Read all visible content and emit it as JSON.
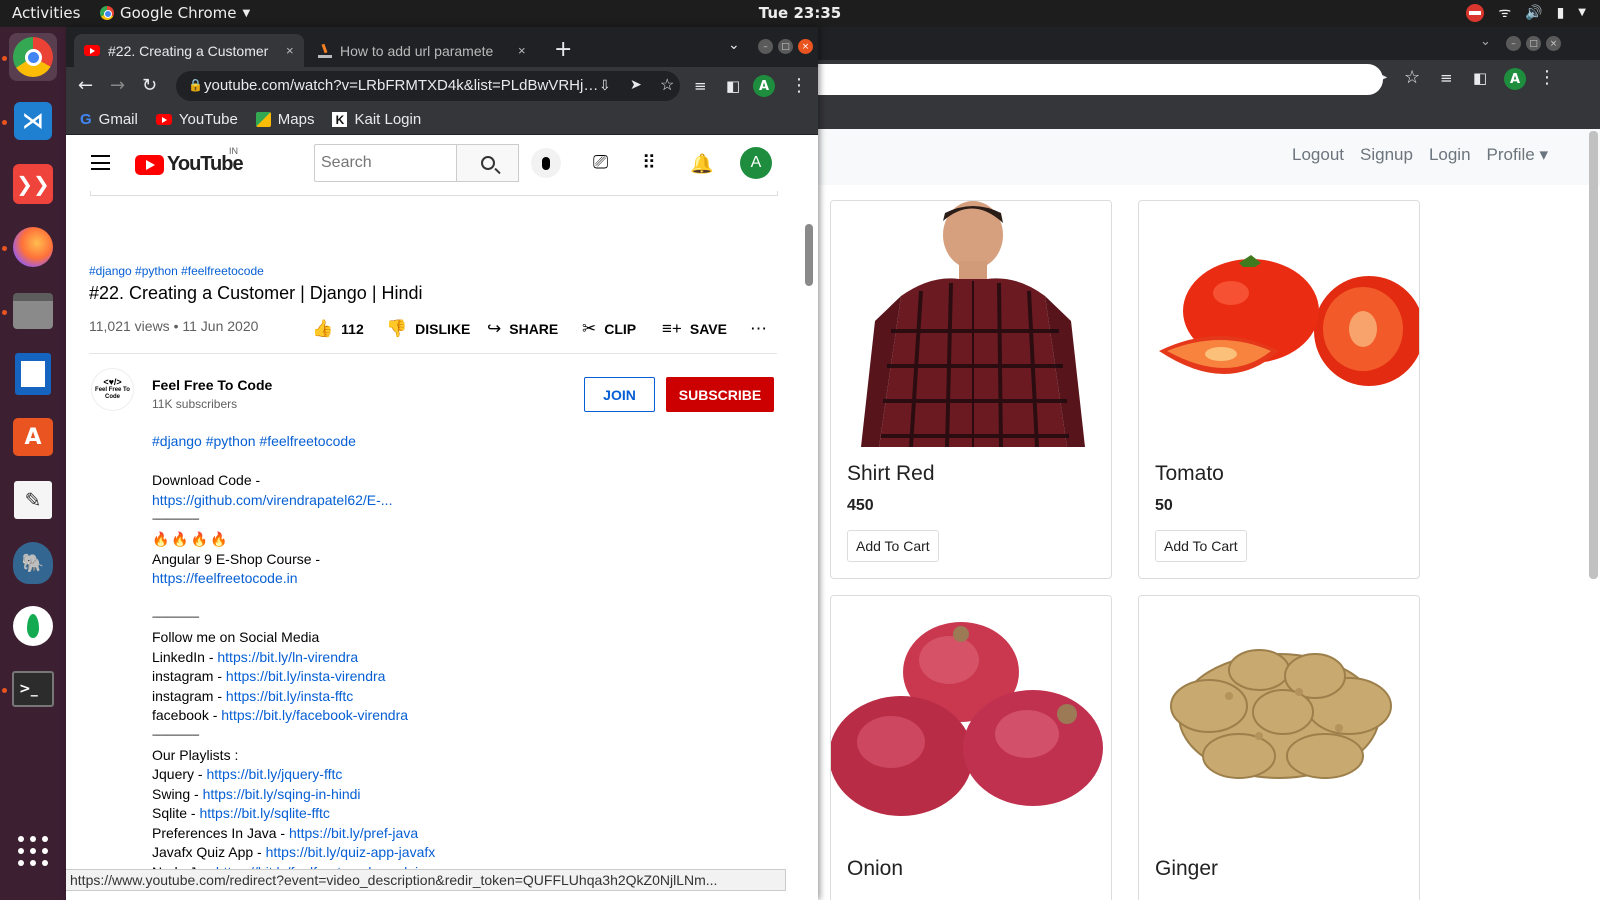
{
  "topbar": {
    "activities": "Activities",
    "app_name": "Google Chrome",
    "clock": "Tue 23:35"
  },
  "dock": {
    "items": [
      "chrome-icon",
      "vscode-icon",
      "anydesk-icon",
      "firefox-icon",
      "files-icon",
      "writer-icon",
      "software-icon",
      "text-editor-icon",
      "postgres-icon",
      "mongodb-icon",
      "terminal-icon",
      "show-apps-icon"
    ]
  },
  "browser": {
    "tabs": [
      {
        "label": "#22. Creating a Customer",
        "close": "×"
      },
      {
        "label": "How to add url paramete",
        "close": "×"
      }
    ],
    "new_tab": "+",
    "url": "youtube.com/watch?v=LRbFRMTXD4k&list=PLdBwVRHjcI...",
    "profile_initial": "A",
    "bookmarks": [
      {
        "label": "Gmail"
      },
      {
        "label": "YouTube"
      },
      {
        "label": "Maps"
      },
      {
        "label": "Kait Login"
      }
    ],
    "status_url": "https://www.youtube.com/redirect?event=video_description&redir_token=QUFFLUhqa3h2QkZ0NjlLNm..."
  },
  "youtube": {
    "logo": "YouTube",
    "country": "IN",
    "search_placeholder": "Search",
    "avatar_initial": "A",
    "hashtags": "#django #python #feelfreetocode",
    "title": "#22. Creating a Customer | Django | Hindi",
    "views": "11,021 views • 11 Jun 2020",
    "likes": "112",
    "dislike": "DISLIKE",
    "share": "SHARE",
    "clip": "CLIP",
    "save": "SAVE",
    "channel": {
      "name": "Feel Free To Code",
      "subscribers": "11K subscribers",
      "avatar_top": "<♥/>",
      "avatar_bottom": "Feel Free To Code",
      "join": "JOIN",
      "subscribe": "SUBSCRIBE"
    },
    "description": {
      "hashtags": "#django #python #feelfreetocode",
      "download_label": "Download Code -",
      "download_link": "https://github.com/virendrapatel62/E-...",
      "sep1": "--------------------",
      "fire": "🔥🔥🔥🔥",
      "angular_label": "Angular 9 E-Shop Course -",
      "angular_link": "https://feelfreetocode.in",
      "sep2": "--------------------",
      "follow_label": "Follow me on Social Media",
      "social": [
        {
          "label": "LinkedIn - ",
          "link": "https://bit.ly/ln-virendra"
        },
        {
          "label": "instagram - ",
          "link": "https://bit.ly/insta-virendra"
        },
        {
          "label": "instagram - ",
          "link": "https://bit.ly/insta-fftc"
        },
        {
          "label": "facebook - ",
          "link": "https://bit.ly/facebook-virendra"
        }
      ],
      "sep3": "--------------------",
      "playlists_label": "Our Playlists :",
      "playlists": [
        {
          "label": "Jquery - ",
          "link": "https://bit.ly/jquery-fftc"
        },
        {
          "label": "Swing - ",
          "link": "https://bit.ly/sqing-in-hindi"
        },
        {
          "label": "Sqlite - ",
          "link": "https://bit.ly/sqlite-fftc"
        },
        {
          "label": "Preferences In Java - ",
          "link": "https://bit.ly/pref-java"
        },
        {
          "label": "Javafx Quiz App - ",
          "link": "https://bit.ly/quiz-app-javafx"
        },
        {
          "label": "Node Js - ",
          "link": "https://bit.ly/feelfreetocode-nodejs"
        }
      ]
    }
  },
  "shop": {
    "nav": [
      "Logout",
      "Signup",
      "Login",
      "Profile ▾"
    ],
    "products": [
      {
        "name": "Shirt Red",
        "price": "450",
        "button": "Add To Cart"
      },
      {
        "name": "Tomato",
        "price": "50",
        "button": "Add To Cart"
      },
      {
        "name": "Onion"
      },
      {
        "name": "Ginger"
      }
    ]
  }
}
